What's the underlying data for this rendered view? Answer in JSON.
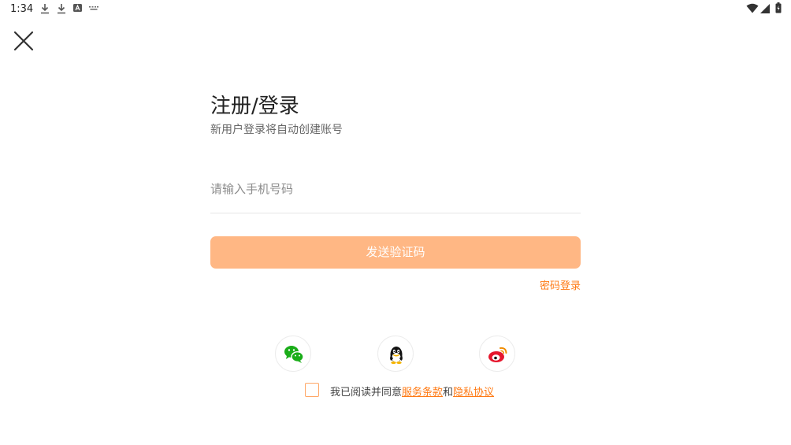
{
  "status_bar": {
    "time": "1:34",
    "left_icons": [
      "download-icon",
      "download-icon",
      "a-badge-icon",
      "keyboard-icon"
    ],
    "right_icons": [
      "wifi-icon",
      "signal-icon",
      "battery-icon"
    ]
  },
  "header": {
    "close_icon": "close-icon"
  },
  "login": {
    "title": "注册/登录",
    "subtitle": "新用户登录将自动创建账号",
    "phone_placeholder": "请输入手机号码",
    "send_code_label": "发送验证码",
    "password_login_label": "密码登录"
  },
  "social": [
    {
      "icon": "wechat-icon",
      "color": "#1aad19"
    },
    {
      "icon": "qq-icon",
      "color": "#111111"
    },
    {
      "icon": "weibo-icon",
      "color": "#e6162d"
    }
  ],
  "agreement": {
    "prefix": "我已阅读并同意",
    "terms_label": "服务条款",
    "conjunction": "和",
    "privacy_label": "隐私协议"
  },
  "colors": {
    "accent": "#ff7a14",
    "button_bg": "#ffb784",
    "checkbox_border": "#ffa766"
  }
}
